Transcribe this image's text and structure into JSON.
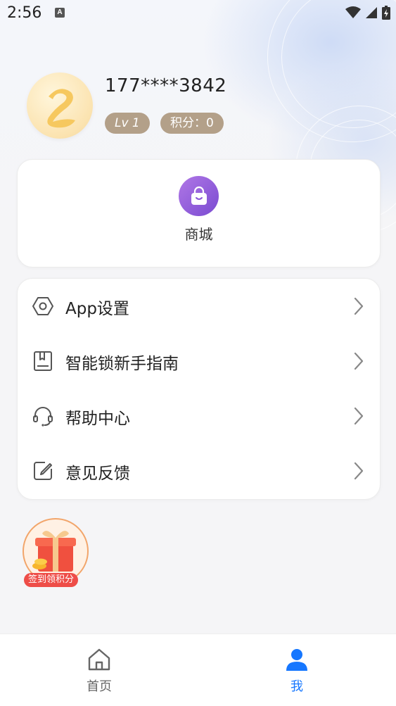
{
  "status_bar": {
    "time": "2:56",
    "notification_icon": "A"
  },
  "profile": {
    "phone": "177****3842",
    "level": "Lv 1",
    "points_label": "积分：0"
  },
  "mall": {
    "label": "商城",
    "icon": "shopping-bag-icon"
  },
  "menu": [
    {
      "label": "App设置",
      "icon": "hexagon-settings-icon"
    },
    {
      "label": "智能锁新手指南",
      "icon": "book-icon"
    },
    {
      "label": "帮助中心",
      "icon": "headset-icon"
    },
    {
      "label": "意见反馈",
      "icon": "edit-note-icon"
    }
  ],
  "checkin": {
    "label": "签到领积分"
  },
  "tabbar": {
    "home_label": "首页",
    "me_label": "我",
    "active_color": "#1677ff",
    "inactive_color": "#666666"
  },
  "colors": {
    "pill": "#b3a089",
    "mall_icon": "#8a55d9"
  }
}
